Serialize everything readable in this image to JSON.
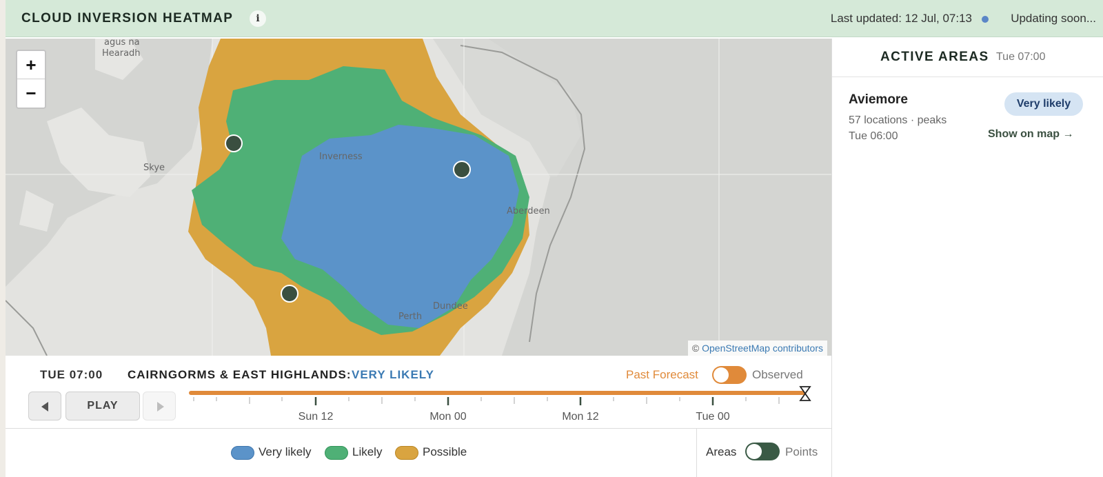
{
  "header": {
    "title": "CLOUD INVERSION HEATMAP",
    "info_label": "i",
    "last_updated": "Last updated: 12 Jul, 07:13",
    "status": "Updating soon...",
    "status_color": "#5b86c7"
  },
  "map": {
    "zoom_in": "+",
    "zoom_out": "−",
    "attribution_prefix": "© ",
    "attribution_link": "OpenStreetMap contributors",
    "place_labels": [
      "agus na",
      "Hearadh",
      "Skye",
      "Inverness",
      "Aberdeen",
      "Dundee",
      "Perth"
    ]
  },
  "timeline": {
    "current_time": "TUE 07:00",
    "region": "CAIRNGORMS & EAST HIGHLANDS:",
    "region_level": "VERY LIKELY",
    "past_forecast": "Past Forecast",
    "observed": "Observed",
    "play": "PLAY",
    "tick_labels": [
      "Sun 12",
      "Mon 00",
      "Mon 12",
      "Tue 00"
    ],
    "track_color": "#e08a3a"
  },
  "legend": {
    "items": [
      {
        "label": "Very likely",
        "color": "#5b93c9"
      },
      {
        "label": "Likely",
        "color": "#4fb076"
      },
      {
        "label": "Possible",
        "color": "#d9a440"
      }
    ],
    "areas": "Areas",
    "points": "Points"
  },
  "side": {
    "title": "ACTIVE AREAS",
    "time": "Tue 07:00",
    "area": {
      "name": "Aviemore",
      "meta_line1": "57 locations · peaks",
      "meta_line2": "Tue 06:00",
      "badge": "Very likely",
      "link": "Show on map →"
    }
  }
}
